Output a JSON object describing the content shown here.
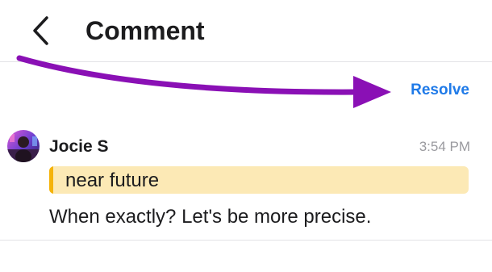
{
  "header": {
    "title": "Comment",
    "back_icon": "chevron-left-icon"
  },
  "actions": {
    "resolve_label": "Resolve"
  },
  "comment": {
    "author": "Jocie S",
    "time": "3:54 PM",
    "quote": "near future",
    "text": "When exactly? Let's be more precise."
  },
  "colors": {
    "accent": "#1f7ae8",
    "annotation_arrow": "#8a10b5",
    "quote_bg": "#fce9b5",
    "quote_bar": "#f5b30a"
  }
}
